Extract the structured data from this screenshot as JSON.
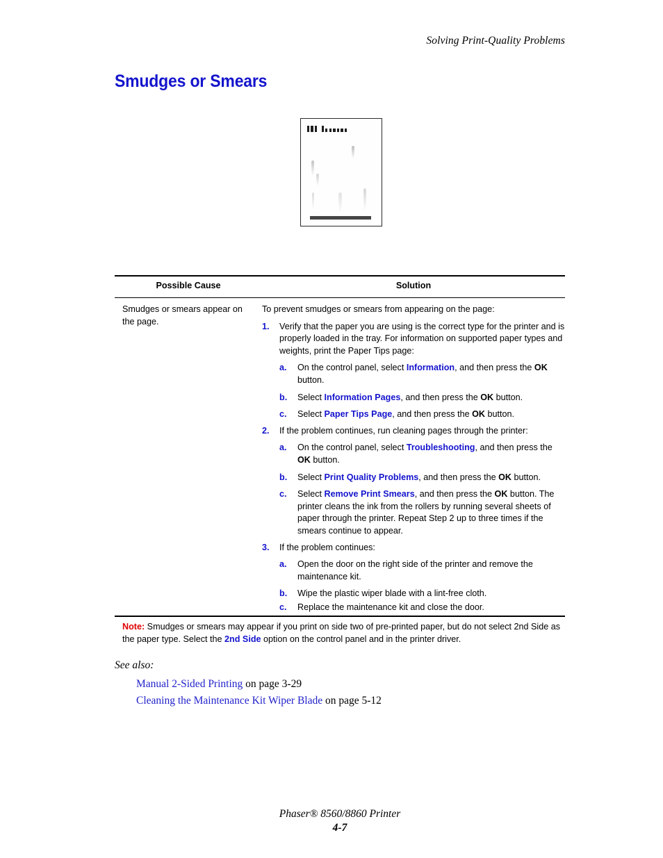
{
  "running_head": "Solving Print-Quality Problems",
  "section_title": "Smudges or Smears",
  "illustration": {
    "name": "smudged-printed-page-illustration",
    "description": "Printed page showing vertical ink smears"
  },
  "table": {
    "headers": {
      "cause": "Possible Cause",
      "solution": "Solution"
    },
    "cause": "Smudges or smears appear on the page.",
    "solution_intro": "To prevent smudges or smears from appearing on the page:",
    "steps": [
      {
        "marker": "1.",
        "text": "Verify that the paper you are using is the correct type for the printer and is properly loaded in the tray. For information on supported paper types and weights, print the Paper Tips page:",
        "substeps": [
          {
            "marker": "a.",
            "parts": [
              {
                "text": "On the control panel, select ",
                "style": "normal"
              },
              {
                "text": "Information",
                "style": "ui-term"
              },
              {
                "text": ", and then press the ",
                "style": "normal"
              },
              {
                "text": "OK",
                "style": "key"
              },
              {
                "text": " button.",
                "style": "normal"
              }
            ]
          },
          {
            "marker": "b.",
            "parts": [
              {
                "text": "Select ",
                "style": "normal"
              },
              {
                "text": "Information Pages",
                "style": "ui-term"
              },
              {
                "text": ", and then press the ",
                "style": "normal"
              },
              {
                "text": "OK",
                "style": "key"
              },
              {
                "text": " button.",
                "style": "normal"
              }
            ]
          },
          {
            "marker": "c.",
            "parts": [
              {
                "text": "Select ",
                "style": "normal"
              },
              {
                "text": "Paper Tips Page",
                "style": "ui-term"
              },
              {
                "text": ", and then press the ",
                "style": "normal"
              },
              {
                "text": "OK",
                "style": "key"
              },
              {
                "text": " button.",
                "style": "normal"
              }
            ]
          }
        ]
      },
      {
        "marker": "2.",
        "text": "If the problem continues, run cleaning pages through the printer:",
        "substeps": [
          {
            "marker": "a.",
            "parts": [
              {
                "text": "On the control panel, select ",
                "style": "normal"
              },
              {
                "text": "Troubleshooting",
                "style": "ui-term"
              },
              {
                "text": ", and then press the ",
                "style": "normal"
              },
              {
                "text": "OK",
                "style": "key"
              },
              {
                "text": " button.",
                "style": "normal"
              }
            ]
          },
          {
            "marker": "b.",
            "parts": [
              {
                "text": "Select ",
                "style": "normal"
              },
              {
                "text": "Print Quality Problems",
                "style": "ui-term"
              },
              {
                "text": ", and then press the ",
                "style": "normal"
              },
              {
                "text": "OK",
                "style": "key"
              },
              {
                "text": " button.",
                "style": "normal"
              }
            ]
          },
          {
            "marker": "c.",
            "parts": [
              {
                "text": "Select ",
                "style": "normal"
              },
              {
                "text": "Remove Print Smears",
                "style": "ui-term"
              },
              {
                "text": ", and then press the ",
                "style": "normal"
              },
              {
                "text": "OK",
                "style": "key"
              },
              {
                "text": " button. The printer cleans the ink from the rollers by running several sheets of paper through the printer. Repeat Step 2 up to three times if the smears continue to appear.",
                "style": "normal"
              }
            ]
          }
        ]
      },
      {
        "marker": "3.",
        "text": "If the problem continues:",
        "substeps": [
          {
            "marker": "a.",
            "parts": [
              {
                "text": "Open the door on the right side of the printer and remove the maintenance kit.",
                "style": "normal"
              }
            ]
          },
          {
            "marker": "b.",
            "tight": true,
            "parts": [
              {
                "text": "Wipe the plastic wiper blade with a lint-free cloth.",
                "style": "normal"
              }
            ]
          },
          {
            "marker": "c.",
            "parts": [
              {
                "text": "Replace the maintenance kit and close the door.",
                "style": "normal"
              }
            ]
          }
        ]
      }
    ]
  },
  "note": {
    "label": "Note:",
    "parts": [
      {
        "text": " Smudges or smears may appear if you print on side two of pre-printed paper, but do not select 2nd Side as the paper type. Select the ",
        "style": "normal"
      },
      {
        "text": "2nd Side",
        "style": "ui-term"
      },
      {
        "text": " option on the control panel and in the printer driver.",
        "style": "normal"
      }
    ]
  },
  "see_also": {
    "label": "See also:",
    "links": [
      {
        "title": "Manual 2-Sided Printing",
        "page_text": " on page 3-29"
      },
      {
        "title": "Cleaning the Maintenance Kit Wiper Blade",
        "page_text": " on page 5-12"
      }
    ]
  },
  "footer": {
    "product": "Phaser® 8560/8860 Printer",
    "folio": "4-7"
  },
  "colors": {
    "link_blue": "#1414cd",
    "xref_blue": "#2222cc",
    "note_red": "#e00000",
    "rule_black": "#000000"
  }
}
